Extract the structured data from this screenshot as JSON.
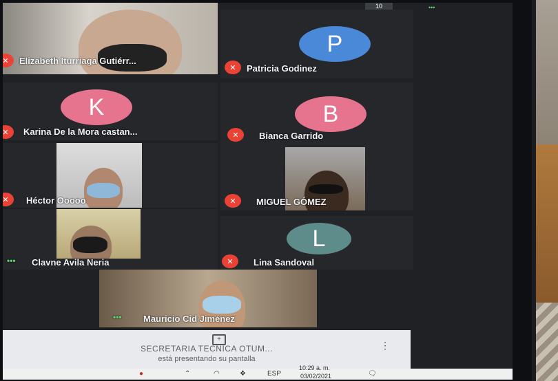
{
  "meeting": {
    "top_counter": "10",
    "participants": [
      {
        "id": "elizabeth",
        "name": "Elizabeth Iturriaga Gutiérr..."
      },
      {
        "id": "patricia",
        "name": "Patricia Godinez",
        "initial": "P"
      },
      {
        "id": "karina",
        "name": "Karina De la Mora castan...",
        "initial": "K"
      },
      {
        "id": "bianca",
        "name": "Bianca Garrido",
        "initial": "B"
      },
      {
        "id": "hector",
        "name": "Héctor Ooooo"
      },
      {
        "id": "miguel",
        "name": "MIGUEL GÓMEZ"
      },
      {
        "id": "clavne",
        "name": "Clavne Avila Neria"
      },
      {
        "id": "lina",
        "name": "Lina Sandoval",
        "initial": "L"
      },
      {
        "id": "mauricio",
        "name": "Mauricio Cid Jiménez"
      }
    ],
    "presenting": {
      "title": "SECRETARIA TECNICA OTUM...",
      "subtitle": "está presentando su pantalla"
    }
  },
  "taskbar": {
    "language": "ESP",
    "time": "10:29 a. m.",
    "date": "03/02/2021"
  },
  "colors": {
    "mic_muted": "#ea4335",
    "avatar_blue": "#4a88d8",
    "avatar_pink": "#e6748e",
    "avatar_teal": "#5d8c8a"
  }
}
